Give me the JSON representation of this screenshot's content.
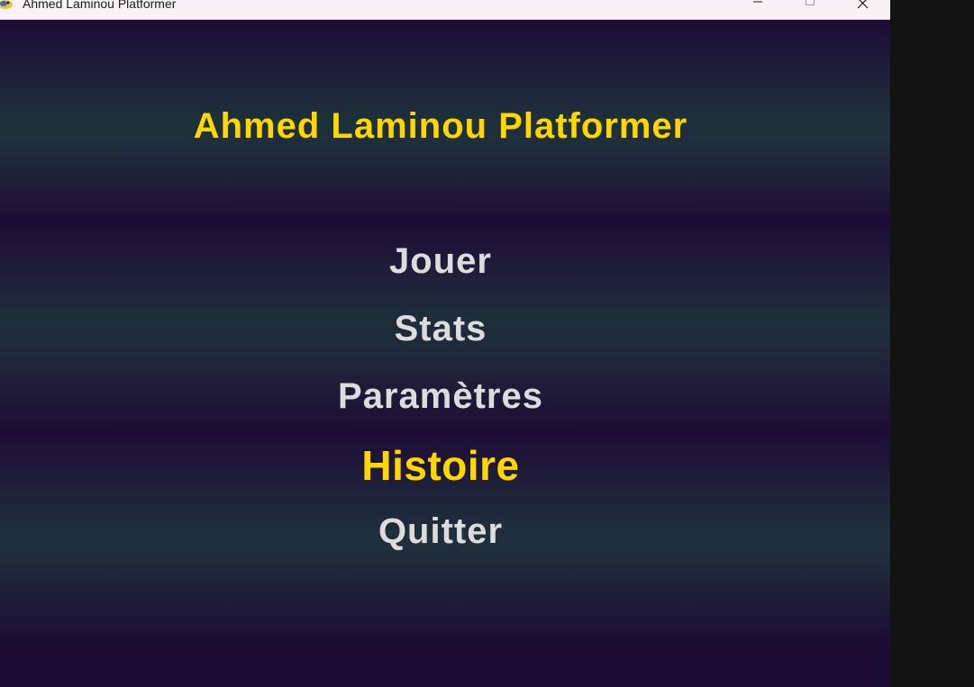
{
  "window": {
    "title": "Ahmed Laminou Platformer",
    "icon": "pygame-snake-icon",
    "controls": [
      "minimize-icon",
      "maximize-icon",
      "close-icon"
    ]
  },
  "game": {
    "title": "Ahmed Laminou Platformer",
    "menu": [
      {
        "label": "Jouer",
        "selected": false
      },
      {
        "label": "Stats",
        "selected": false
      },
      {
        "label": "Paramètres",
        "selected": false
      },
      {
        "label": "Histoire",
        "selected": true
      },
      {
        "label": "Quitter",
        "selected": false
      }
    ]
  },
  "colors": {
    "title": "#ffd700",
    "menu_item": "#dcdcdc",
    "menu_selected": "#ffd700",
    "background_dark": "#1d0c35",
    "background_band": "#1f2f3b"
  }
}
